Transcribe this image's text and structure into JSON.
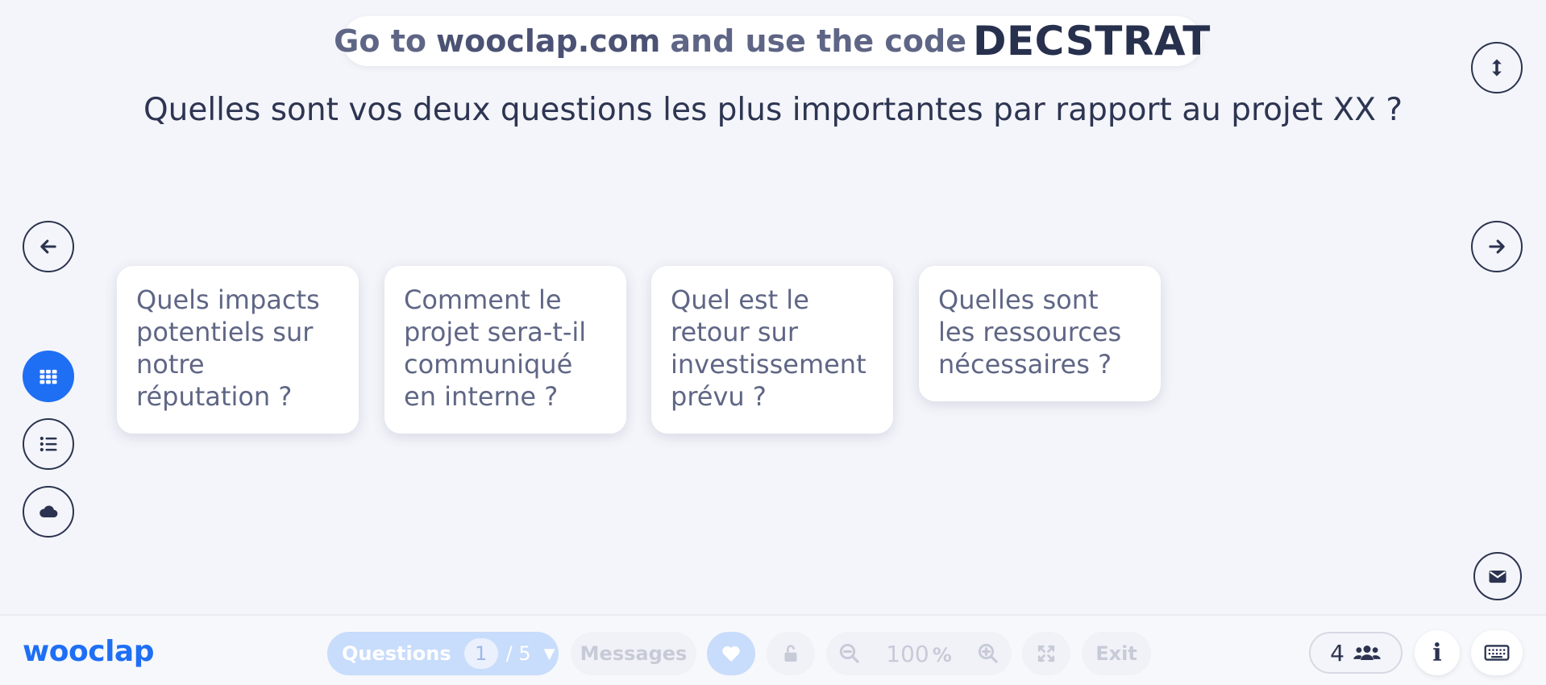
{
  "join_banner": {
    "prefix": "Go to",
    "url": "wooclap.com",
    "middle": "and use the code",
    "code": "DECSTRAT"
  },
  "question": {
    "title": "Quelles sont vos deux questions les plus importantes par rapport au projet XX ?"
  },
  "answers": [
    {
      "text": "Quels impacts potentiels sur notre réputation ?"
    },
    {
      "text": "Comment le projet sera-t-il communiqué en interne ?"
    },
    {
      "text": "Quel est le retour sur investissement prévu ?"
    },
    {
      "text": "Quelles sont les ressources nécessaires ?"
    }
  ],
  "view_modes": [
    {
      "icon": "grid-icon",
      "active": true
    },
    {
      "icon": "list-icon",
      "active": false
    },
    {
      "icon": "cloud-icon",
      "active": false
    }
  ],
  "bottom_bar": {
    "logo": "wooclap",
    "questions_label": "Questions",
    "current_question": "1",
    "total_questions": "/ 5",
    "messages_label": "Messages",
    "zoom_value": "100",
    "zoom_unit": "%",
    "exit_label": "Exit",
    "participants_count": "4",
    "info_label": "i"
  },
  "colors": {
    "accent": "#1f6ff5",
    "background": "#f4f5fa",
    "text_dark": "#2d3552",
    "card_text": "#5f6685"
  }
}
